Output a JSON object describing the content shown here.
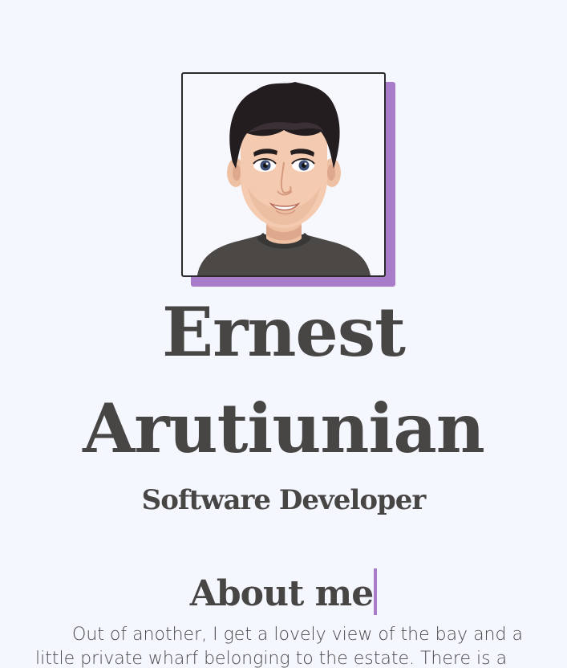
{
  "profile": {
    "first_name": "Ernest",
    "last_name": "Arutiunian",
    "role": "Software Developer",
    "avatar_icon": "cartoon-avatar-man"
  },
  "about": {
    "heading": "About me",
    "text": "Out of another, I get a lovely view of the bay and a little private wharf belonging to the estate. There is a beautiful"
  },
  "colors": {
    "background": "#f5f7fe",
    "accent": "#a87cc9",
    "text": "#484545"
  }
}
